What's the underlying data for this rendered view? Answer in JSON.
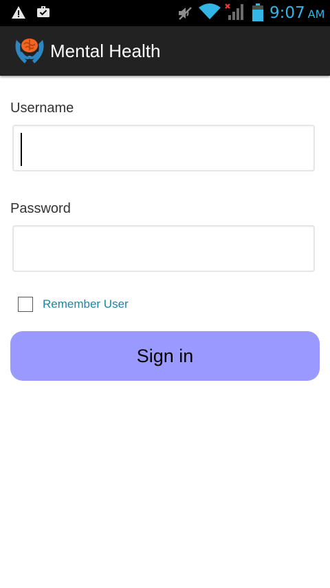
{
  "status_bar": {
    "time": "9:07",
    "ampm": "AM",
    "icons": [
      "warning-icon",
      "briefcase-icon",
      "mute-icon",
      "wifi-icon",
      "signal-icon",
      "battery-icon"
    ]
  },
  "action_bar": {
    "app_icon": "brain-hands-icon",
    "title": "Mental Health"
  },
  "form": {
    "username_label": "Username",
    "username_value": "",
    "password_label": "Password",
    "password_value": "",
    "remember_label": "Remember User",
    "remember_checked": false,
    "signin_label": "Sign in"
  },
  "colors": {
    "accent": "#33b5e5",
    "action_bar": "#222222",
    "signin_button": "#9999ff",
    "remember_text": "#1a86a8"
  }
}
